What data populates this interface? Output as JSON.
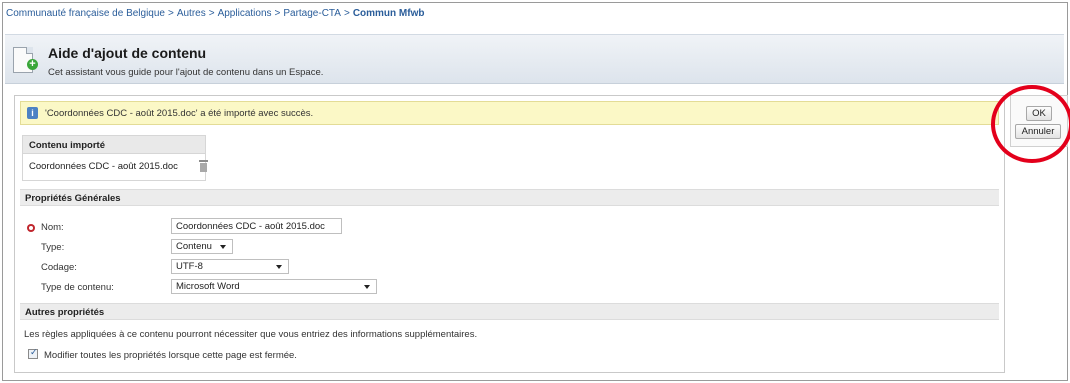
{
  "breadcrumb": {
    "items": [
      "Communauté française de Belgique",
      "Autres",
      "Applications",
      "Partage-CTA"
    ],
    "current": "Commun Mfwb",
    "separator": ">"
  },
  "header": {
    "title": "Aide d'ajout de contenu",
    "subtitle": "Cet assistant vous guide pour l'ajout de contenu dans un Espace."
  },
  "alert": {
    "icon": "info-icon",
    "message": "'Coordonnées CDC - août 2015.doc' a été importé avec succès."
  },
  "imported": {
    "header": "Contenu importé",
    "file_name": "Coordonnées CDC - août 2015.doc",
    "delete_icon": "trash-icon"
  },
  "general": {
    "section_title": "Propriétés Générales",
    "name_label": "Nom:",
    "name_value": "Coordonnées CDC - août 2015.doc",
    "type_label": "Type:",
    "type_value": "Contenu",
    "encoding_label": "Codage:",
    "encoding_value": "UTF-8",
    "content_type_label": "Type de contenu:",
    "content_type_value": "Microsoft Word"
  },
  "other": {
    "section_title": "Autres propriétés",
    "info": "Les règles appliquées à ce contenu pourront nécessiter que vous entriez des informations supplémentaires.",
    "checkbox_label": "Modifier toutes les propriétés lorsque cette page est fermée.",
    "checkbox_checked": true
  },
  "buttons": {
    "ok": "OK",
    "cancel": "Annuler"
  },
  "colors": {
    "link": "#2a5d9a",
    "alert_bg": "#fbf8c6",
    "highlight": "#e3001b",
    "required": "#c0262d"
  }
}
